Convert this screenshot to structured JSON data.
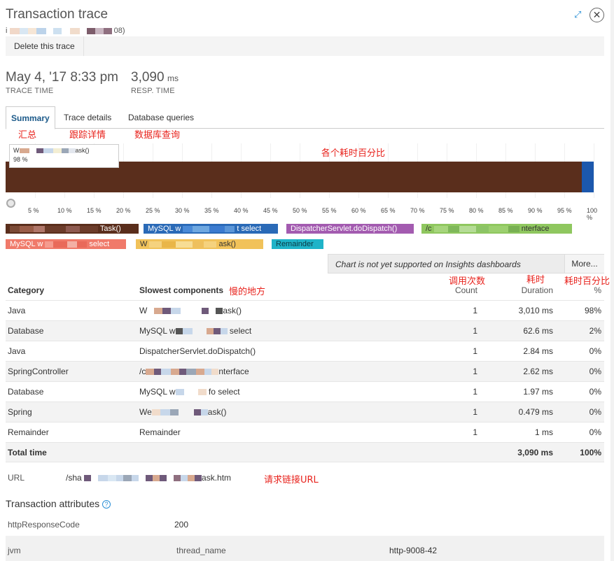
{
  "header": {
    "title": "Transaction trace",
    "subtitle_prefix": "i",
    "subtitle_suffix": "08)"
  },
  "toolbar": {
    "delete_label": "Delete this trace"
  },
  "stats": {
    "trace_time_value": "May 4, '17 8:33 pm",
    "trace_time_label": "TRACE TIME",
    "resp_time_value": "3,090",
    "resp_time_unit": "ms",
    "resp_time_label": "RESP. TIME"
  },
  "tabs": [
    {
      "label": "Summary",
      "annotation": "汇总"
    },
    {
      "label": "Trace details",
      "annotation": "跟踪详情"
    },
    {
      "label": "Database queries",
      "annotation": "数据库查询"
    }
  ],
  "annotations": {
    "percent_of_time": "各个耗时百分比",
    "slow_spots": "慢的地方",
    "call_count": "调用次数",
    "elapsed": "耗时",
    "elapsed_percent": "耗时百分比",
    "request_url": "请求链接URL"
  },
  "tooltip": {
    "name_start": "W",
    "name_end": "ask()",
    "percent": "98 %"
  },
  "chart_data": {
    "type": "bar",
    "stacked": true,
    "series": [
      {
        "value": 98,
        "color": "#5a2e1c"
      },
      {
        "value": 2,
        "color": "#1c58ad"
      }
    ],
    "xlim": [
      0,
      100
    ],
    "tick_labels": [
      "5 %",
      "10 %",
      "15 %",
      "20 %",
      "25 %",
      "30 %",
      "35 %",
      "40 %",
      "45 %",
      "50 %",
      "55 %",
      "60 %",
      "65 %",
      "70 %",
      "75 %",
      "80 %",
      "85 %",
      "90 %",
      "95 %",
      "100 %"
    ],
    "grid": true
  },
  "legend": [
    {
      "text": "Task()",
      "color": "#5a2e1c"
    },
    {
      "text": "MySQL w",
      "text_end": "t select",
      "color": "#2a6ab7"
    },
    {
      "text": "DispatcherServlet.doDispatch()",
      "color": "#a35bb0"
    },
    {
      "text": "/c",
      "text_end": "nterface",
      "color": "#8fc75f"
    },
    {
      "text": "MySQL w",
      "text_end": "select",
      "color": "#f07a6a"
    },
    {
      "text": "W",
      "text_end": "ask()",
      "color": "#f1c25a"
    },
    {
      "text": "Remainder",
      "color": "#1fb3c8"
    }
  ],
  "insights": {
    "message": "Chart is not yet supported on Insights dashboards",
    "more_label": "More..."
  },
  "table": {
    "headers": {
      "category": "Category",
      "slowest": "Slowest components",
      "count_top": "Count",
      "duration": "Duration",
      "percent": "%"
    },
    "rows": [
      {
        "category": "Java",
        "component": "W",
        "component_end": "ask()",
        "count": "1",
        "duration": "3,010 ms",
        "percent": "98%"
      },
      {
        "category": "Database",
        "component": "MySQL w",
        "component_end": "select",
        "count": "1",
        "duration": "62.6 ms",
        "percent": "2%"
      },
      {
        "category": "Java",
        "component": "DispatcherServlet.doDispatch()",
        "component_end": "",
        "count": "1",
        "duration": "2.84 ms",
        "percent": "0%"
      },
      {
        "category": "SpringController",
        "component": "/c",
        "component_end": "nterface",
        "count": "1",
        "duration": "2.62 ms",
        "percent": "0%"
      },
      {
        "category": "Database",
        "component": "MySQL w",
        "component_end": "fo select",
        "count": "1",
        "duration": "1.97 ms",
        "percent": "0%"
      },
      {
        "category": "Spring",
        "component": "We",
        "component_end": "ask()",
        "count": "1",
        "duration": "0.479 ms",
        "percent": "0%"
      },
      {
        "category": "Remainder",
        "component": "Remainder",
        "component_end": "",
        "count": "1",
        "duration": "1 ms",
        "percent": "0%"
      }
    ],
    "total": {
      "label": "Total time",
      "duration": "3,090 ms",
      "percent": "100%"
    }
  },
  "url": {
    "label": "URL",
    "value_start": "/sha",
    "value_end": "ask.htm"
  },
  "attributes": {
    "title": "Transaction attributes",
    "rows": [
      {
        "key": "httpResponseCode",
        "value": "200"
      },
      {
        "key": "jvm",
        "key2": "thread_name",
        "value": "http-9008-42"
      }
    ]
  }
}
